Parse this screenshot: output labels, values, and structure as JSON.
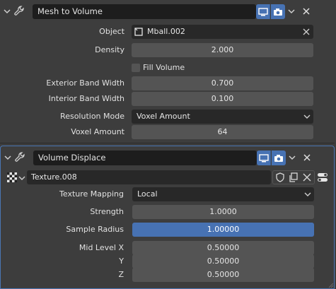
{
  "mesh_to_volume": {
    "name": "Mesh to Volume",
    "object": {
      "label": "Object",
      "value": "Mball.002"
    },
    "density": {
      "label": "Density",
      "value": "2.000"
    },
    "fill_volume": {
      "label": "Fill Volume",
      "checked": false
    },
    "exterior_band_width": {
      "label": "Exterior Band Width",
      "value": "0.700"
    },
    "interior_band_width": {
      "label": "Interior Band Width",
      "value": "0.100"
    },
    "resolution_mode": {
      "label": "Resolution Mode",
      "value": "Voxel Amount"
    },
    "voxel_amount": {
      "label": "Voxel Amount",
      "value": "64"
    }
  },
  "volume_displace": {
    "name": "Volume Displace",
    "texture": {
      "value": "Texture.008"
    },
    "texture_mapping": {
      "label": "Texture Mapping",
      "value": "Local"
    },
    "strength": {
      "label": "Strength",
      "value": "1.0000"
    },
    "sample_radius": {
      "label": "Sample Radius",
      "value": "1.00000"
    },
    "mid_level_x": {
      "label": "Mid Level X",
      "value": "0.50000"
    },
    "mid_level_y": {
      "label": "Y",
      "value": "0.50000"
    },
    "mid_level_z": {
      "label": "Z",
      "value": "0.50000"
    }
  },
  "colors": {
    "accent": "#4772b3",
    "field": "#545454",
    "dark_field": "#282828",
    "panel": "#3d3d3d"
  },
  "icons": [
    "chevron-down-icon",
    "wrench-icon",
    "monitor-icon",
    "camera-icon",
    "close-icon",
    "object-icon",
    "texture-checker-icon",
    "shield-icon",
    "duplicate-icon",
    "unlink-icon",
    "toggle-icon"
  ]
}
